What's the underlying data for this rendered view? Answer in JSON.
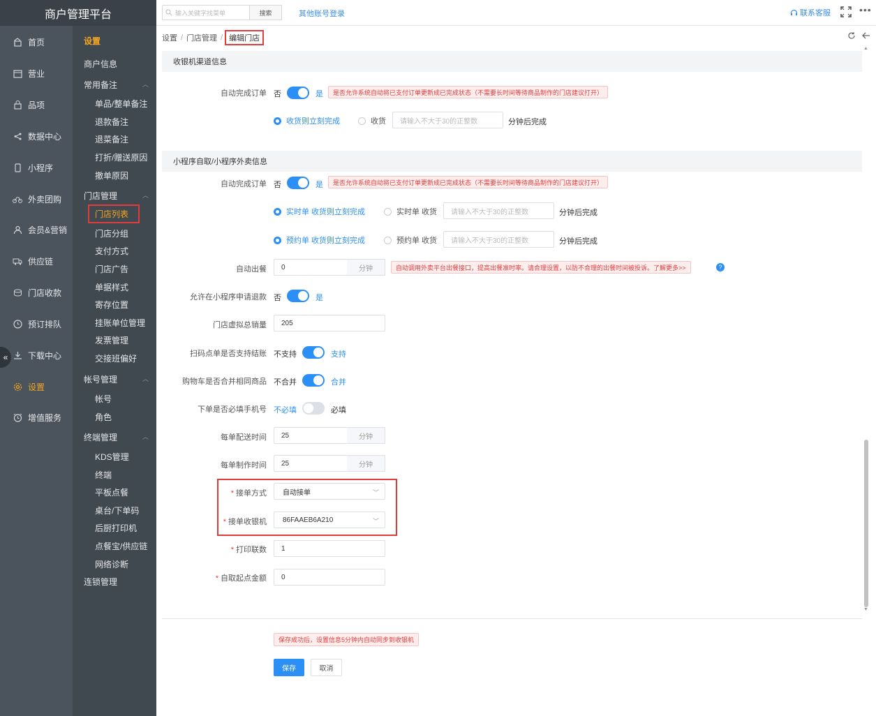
{
  "app": {
    "title": "商户管理平台"
  },
  "nav": {
    "items": [
      {
        "label": "首页",
        "icon": "home-icon"
      },
      {
        "label": "营业",
        "icon": "calendar-icon"
      },
      {
        "label": "品项",
        "icon": "bag-icon"
      },
      {
        "label": "数据中心",
        "icon": "share-icon"
      },
      {
        "label": "小程序",
        "icon": "phone-icon"
      },
      {
        "label": "外卖团购",
        "icon": "bike-icon"
      },
      {
        "label": "会员&营销",
        "icon": "user-icon"
      },
      {
        "label": "供应链",
        "icon": "truck-icon"
      },
      {
        "label": "门店收款",
        "icon": "coins-icon"
      },
      {
        "label": "预订排队",
        "icon": "clock-icon"
      },
      {
        "label": "下载中心",
        "icon": "download-icon"
      },
      {
        "label": "设置",
        "icon": "settings-icon",
        "active": true
      },
      {
        "label": "增值服务",
        "icon": "alarm-icon"
      }
    ],
    "collapse_glyph": "«"
  },
  "subnav": {
    "title": "设置",
    "merchant_info": "商户信息",
    "groups": [
      {
        "label": "常用备注",
        "items": [
          "单品/整单备注",
          "退款备注",
          "退菜备注",
          "打折/赠送原因",
          "撤单原因"
        ]
      },
      {
        "label": "门店管理",
        "items": [
          "门店列表",
          "门店分组",
          "支付方式",
          "门店广告",
          "单据样式",
          "寄存位置",
          "挂账单位管理",
          "发票管理",
          "交接班偏好"
        ]
      },
      {
        "label": "帐号管理",
        "items": [
          "帐号",
          "角色"
        ]
      },
      {
        "label": "终端管理",
        "items": [
          "KDS管理",
          "终端",
          "平板点餐",
          "桌台/下单码",
          "后厨打印机",
          "点餐宝/供应链",
          "网络诊断"
        ]
      }
    ],
    "chain": "连锁管理",
    "caret": "︿"
  },
  "topbar": {
    "search_placeholder": "输入关键字找菜单",
    "search_button": "搜索",
    "other_login": "其他账号登录",
    "contact": "联系客服",
    "more": "•••"
  },
  "breadcrumb": {
    "items": [
      "设置",
      "门店管理",
      "编辑门店"
    ],
    "sep": "/"
  },
  "form": {
    "cashier_section": "收银机渠道信息",
    "auto_complete_label": "自动完成订单",
    "no": "否",
    "yes": "是",
    "auto_complete_warn": "是否允许系统自动将已支付订单更新成已完成状态（不需要长时间等待商品制作的门店建议打开）",
    "radio_receive_now": "收货则立刻完成",
    "radio_receive": "收货",
    "minutes_placeholder": "请输入不大于30的正整数",
    "after_minutes": "分钟后完成",
    "mini_section": "小程序自取/小程序外卖信息",
    "realtime_now": "实时单 收货则立刻完成",
    "realtime_receive": "实时单 收货",
    "reserve_now": "预约单 收货则立刻完成",
    "reserve_receive": "预约单 收货",
    "auto_meal_label": "自动出餐",
    "auto_meal_value": "0",
    "minute_unit": "分钟",
    "auto_meal_warn": "自动调用外卖平台出餐接口，提高出餐准时率。请合理设置，以防不合理的出餐时间被投诉。了解更多>>",
    "help_glyph": "?",
    "refund_label": "允许在小程序申请退款",
    "virtual_sales_label": "门店虚拟总销量",
    "virtual_sales_value": "205",
    "scan_pay_label": "扫码点单是否支持结账",
    "not_support": "不支持",
    "support": "支持",
    "cart_merge_label": "购物车是否合并相同商品",
    "not_merge": "不合并",
    "merge": "合并",
    "phone_required_label": "下单是否必填手机号",
    "not_required": "不必填",
    "required": "必填",
    "delivery_time_label": "每单配送时间",
    "delivery_time_value": "25",
    "make_time_label": "每单制作时间",
    "make_time_value": "25",
    "accept_mode_label": "接单方式",
    "accept_mode_value": "自动接单",
    "accept_cashier_label": "接单收银机",
    "accept_cashier_value": "86FAAEB6A210",
    "print_copies_label": "打印联数",
    "print_copies_value": "1",
    "pickup_min_label": "自取起点金额",
    "pickup_min_value": "0",
    "req_mark": "*",
    "save_notice": "保存成功后，设置信息5分钟内自动同步到收银机",
    "save": "保存",
    "cancel": "取消"
  },
  "colors": {
    "accent": "#2c8ff5",
    "active_nav": "#f5a623",
    "highlight_box": "#e23b3b"
  }
}
